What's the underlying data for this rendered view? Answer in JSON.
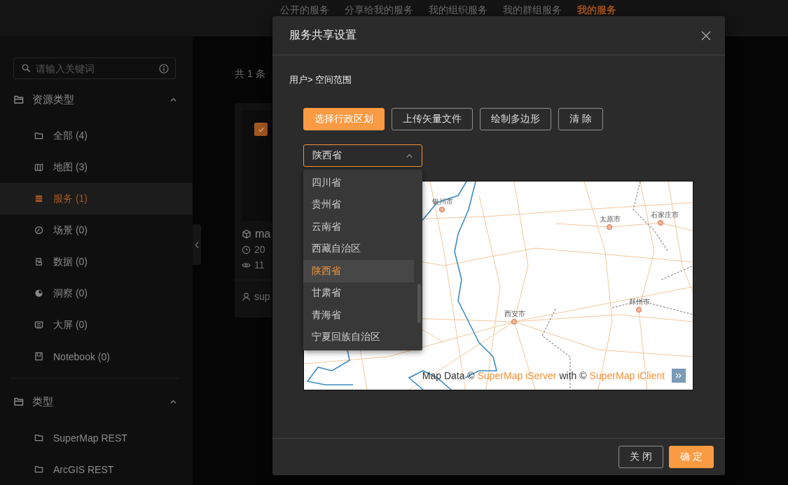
{
  "top_tabs": [
    {
      "label": "公开的服务",
      "selected": false
    },
    {
      "label": "分享给我的服务",
      "selected": false
    },
    {
      "label": "我的组织服务",
      "selected": false
    },
    {
      "label": "我的群组服务",
      "selected": false
    },
    {
      "label": "我的服务",
      "selected": true
    }
  ],
  "sidebar": {
    "search": {
      "placeholder": "请输入关键词"
    },
    "sections": [
      {
        "title": "资源类型",
        "expanded": true,
        "items": [
          {
            "label": "全部 (4)",
            "kind": "all",
            "selected": false
          },
          {
            "label": "地图 (3)",
            "kind": "map",
            "selected": false
          },
          {
            "label": "服务 (1)",
            "kind": "service",
            "selected": true
          },
          {
            "label": "场景 (0)",
            "kind": "scene",
            "selected": false
          },
          {
            "label": "数据 (0)",
            "kind": "data",
            "selected": false
          },
          {
            "label": "洞察 (0)",
            "kind": "insight",
            "selected": false
          },
          {
            "label": "大屏 (0)",
            "kind": "screen",
            "selected": false
          },
          {
            "label": "Notebook (0)",
            "kind": "notebook",
            "selected": false
          }
        ]
      },
      {
        "title": "类型",
        "expanded": true,
        "items": [
          {
            "label": "SuperMap REST",
            "kind": "all",
            "selected": false
          },
          {
            "label": "ArcGIS REST",
            "kind": "all",
            "selected": false
          }
        ]
      }
    ]
  },
  "results": {
    "count_text": "共 1 条",
    "card": {
      "checked": true,
      "name": "ma",
      "date": "20",
      "views": "11",
      "owner": "sup"
    }
  },
  "dialog": {
    "title": "服务共享设置",
    "breadcrumb": "用户> 空间范围",
    "tools": [
      {
        "label": "选择行政区划",
        "selected": true
      },
      {
        "label": "上传矢量文件",
        "selected": false
      },
      {
        "label": "绘制多边形",
        "selected": false
      },
      {
        "label": "清 除",
        "selected": false
      }
    ],
    "region_select": {
      "value": "陕西省",
      "expanded": true,
      "options": [
        {
          "label": "四川省",
          "selected": false
        },
        {
          "label": "贵州省",
          "selected": false
        },
        {
          "label": "云南省",
          "selected": false
        },
        {
          "label": "西藏自治区",
          "selected": false
        },
        {
          "label": "陕西省",
          "selected": true
        },
        {
          "label": "甘肃省",
          "selected": false
        },
        {
          "label": "青海省",
          "selected": false
        },
        {
          "label": "宁夏回族自治区",
          "selected": false
        }
      ]
    },
    "map": {
      "cities": [
        "银川市",
        "太原市",
        "石家庄市",
        "西安市",
        "郑州市"
      ],
      "attribution": [
        {
          "kind": "text",
          "text": "Map Data ©"
        },
        {
          "kind": "link",
          "text": "SuperMap iServer"
        },
        {
          "kind": "text",
          "text": "with ©"
        },
        {
          "kind": "link",
          "text": "SuperMap iClient"
        }
      ]
    },
    "footer_buttons": [
      {
        "label": "关 闭",
        "kind": "default"
      },
      {
        "label": "确 定",
        "kind": "primary"
      }
    ]
  }
}
